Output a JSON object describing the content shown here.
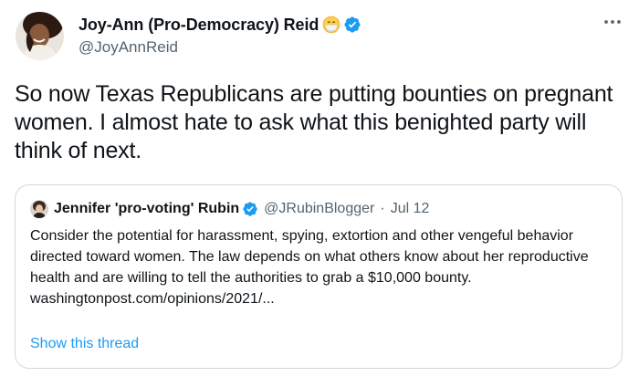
{
  "tweet": {
    "display_name": "Joy-Ann (Pro-Democracy) Reid",
    "handle": "@JoyAnnReid",
    "text": "So now Texas Republicans are putting bounties on pregnant women. I almost hate to ask what this benighted party will think of next.",
    "icons": {
      "emoji": "mask-face-emoji-icon",
      "verified": "verified-badge-icon",
      "more": "more-options-icon"
    }
  },
  "quoted_tweet": {
    "display_name": "Jennifer 'pro-voting' Rubin",
    "handle": "@JRubinBlogger",
    "separator": "·",
    "date": "Jul 12",
    "text": "Consider the potential for harassment, spying, extortion and other vengeful behavior directed toward women. The law depends on what others know about her reproductive health and are willing to tell the authorities to grab a $10,000 bounty.",
    "link": "washingtonpost.com/opinions/2021/...",
    "show_thread": "Show this thread"
  },
  "colors": {
    "text": "#0f1419",
    "secondary": "#536471",
    "accent": "#1d9bf0",
    "border": "#cfd9de"
  }
}
